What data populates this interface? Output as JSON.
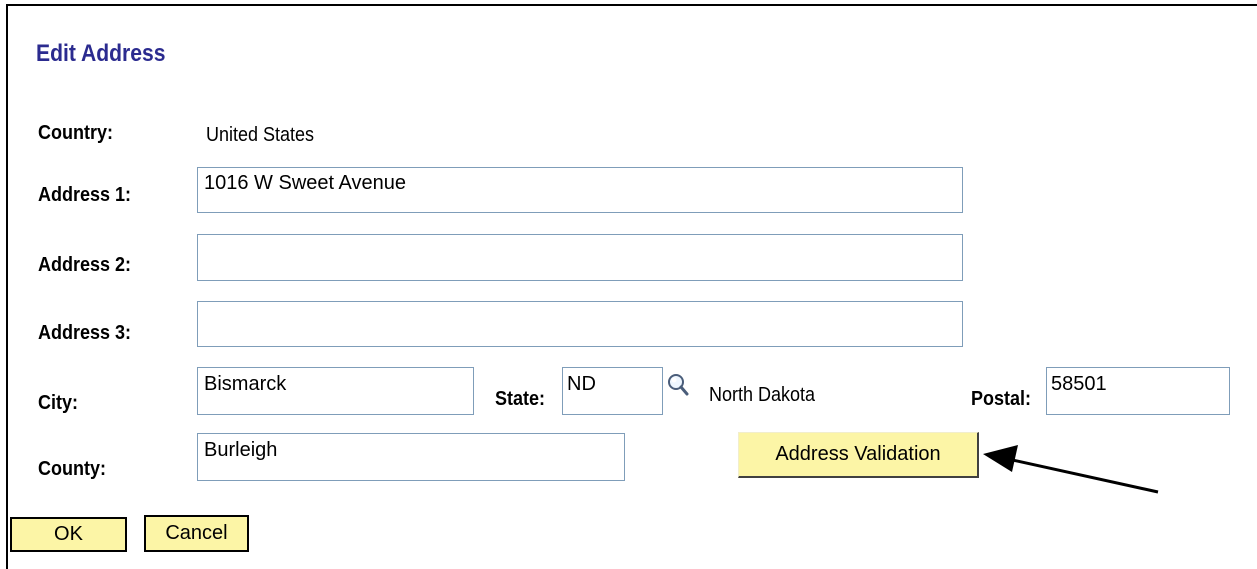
{
  "page": {
    "title": "Edit Address"
  },
  "form": {
    "country_label": "Country:",
    "country_value": "United States",
    "address1_label": "Address 1:",
    "address1_value": "1016 W Sweet Avenue",
    "address2_label": "Address 2:",
    "address2_value": "",
    "address3_label": "Address 3:",
    "address3_value": "",
    "city_label": "City:",
    "city_value": "Bismarck",
    "state_label": "State:",
    "state_value": "ND",
    "state_name": "North Dakota",
    "postal_label": "Postal:",
    "postal_value": "58501",
    "county_label": "County:",
    "county_value": "Burleigh"
  },
  "buttons": {
    "address_validation": "Address Validation",
    "ok": "OK",
    "cancel": "Cancel"
  },
  "icons": {
    "state_lookup": "magnifier-lookup-icon",
    "callout": "callout-arrow"
  },
  "colors": {
    "title": "#2b2b8f",
    "button_bg": "#fcf5a6",
    "input_border": "#7f9db9"
  }
}
